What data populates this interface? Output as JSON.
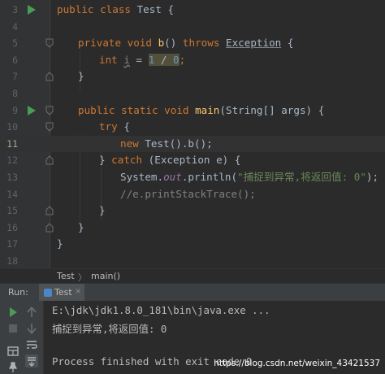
{
  "editor": {
    "lines": [
      {
        "num": "3"
      },
      {
        "num": "4"
      },
      {
        "num": "5"
      },
      {
        "num": "6"
      },
      {
        "num": "7"
      },
      {
        "num": "8"
      },
      {
        "num": "9"
      },
      {
        "num": "10"
      },
      {
        "num": "11"
      },
      {
        "num": "12"
      },
      {
        "num": "13"
      },
      {
        "num": "14"
      },
      {
        "num": "15"
      },
      {
        "num": "16"
      },
      {
        "num": "17"
      },
      {
        "num": "18"
      }
    ],
    "code": {
      "l3_kw": "public class ",
      "l3_name": "Test {",
      "l5_kw": "private void ",
      "l5_method": "b",
      "l5_rest": "() ",
      "l5_throws": "throws ",
      "l5_exc": "Exception",
      "l5_brace": " {",
      "l6_kw": "int ",
      "l6_var": "i",
      "l6_eq": " = ",
      "l6_expr_a": "1",
      "l6_expr_op": " / ",
      "l6_expr_b": "0",
      "l6_semi": ";",
      "l7": "}",
      "l9_kw": "public static void ",
      "l9_method": "main",
      "l9_rest": "(String[] args) {",
      "l10_kw": "try",
      "l10_rest": " {",
      "l11_kw": "new ",
      "l11_rest": "Test().b();",
      "l12_open": "} ",
      "l12_kw": "catch",
      "l12_rest": " (Exception e) {",
      "l13_a": "System.",
      "l13_field": "out",
      "l13_b": ".println(",
      "l13_str": "\"捕捉到异常,将返回值: 0\"",
      "l13_c": ");",
      "l14": "//e.printStackTrace();",
      "l15": "}",
      "l16": "}",
      "l17": "}"
    }
  },
  "breadcrumb": {
    "class": "Test",
    "separator": "〉",
    "method": "main()"
  },
  "run_panel": {
    "label": "Run:",
    "tab_label": "Test",
    "tab_close": "×",
    "console_lines": [
      "E:\\jdk\\jdk1.8.0_181\\bin\\java.exe ...",
      "捕捉到异常,将返回值: 0",
      "",
      "Process finished with exit code 0"
    ]
  },
  "watermark": "https://blog.csdn.net/weixin_43421537",
  "icons": {
    "run_gutter": "run-arrow-icon",
    "fold": "fold-marker-icon",
    "rerun": "rerun-icon",
    "stop": "stop-icon",
    "scroll_up": "up-arrow-icon",
    "scroll_down": "down-arrow-icon",
    "soft_wrap": "soft-wrap-icon",
    "scroll_end": "scroll-to-end-icon",
    "layout": "layout-icon",
    "pin": "pin-icon"
  },
  "colors": {
    "background": "#2b2b2b",
    "keyword": "#cc7832",
    "method": "#ffc66d",
    "number": "#6897bb",
    "string": "#6a8759",
    "comment": "#808080",
    "field": "#9876aa",
    "run_green": "#499c54"
  }
}
